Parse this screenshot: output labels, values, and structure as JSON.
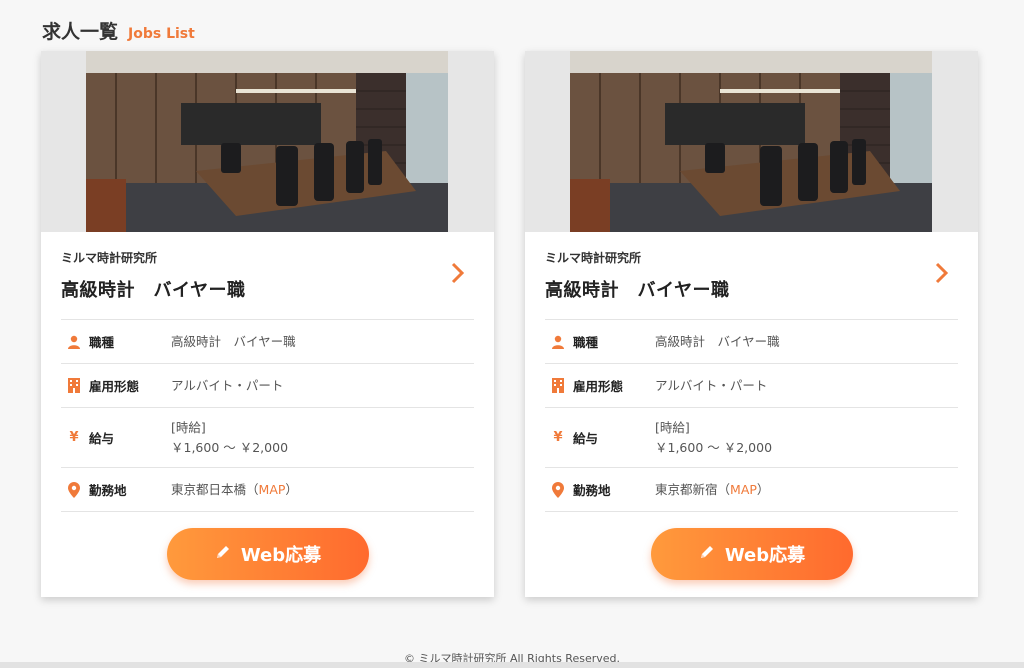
{
  "page": {
    "title_jp": "求人一覧",
    "title_en": "Jobs List"
  },
  "labels": {
    "occupation": "職種",
    "employment_type": "雇用形態",
    "salary": "給与",
    "location": "勤務地",
    "map_link": "MAP",
    "apply_button": "Web応募"
  },
  "jobs": [
    {
      "company": "ミルマ時計研究所",
      "title": "高級時計　バイヤー職",
      "occupation": "高級時計　バイヤー職",
      "employment_type": "アルバイト・パート",
      "salary_type": "[時給]",
      "salary_range": "￥1,600 〜 ￥2,000",
      "location": "東京都日本橋"
    },
    {
      "company": "ミルマ時計研究所",
      "title": "高級時計　バイヤー職",
      "occupation": "高級時計　バイヤー職",
      "employment_type": "アルバイト・パート",
      "salary_type": "[時給]",
      "salary_range": "￥1,600 〜 ￥2,000",
      "location": "東京都新宿"
    }
  ],
  "icons": {
    "occupation": "person-icon",
    "employment_type": "building-icon",
    "salary": "yen-icon",
    "location": "map-pin-icon",
    "apply": "pencil-icon",
    "detail": "chevron-right-icon"
  },
  "colors": {
    "accent": "#f07a3a",
    "button_start": "#ff9a3c",
    "button_end": "#ff6a2e"
  },
  "footer": {
    "copyright": "© ミルマ時計研究所 All Rights Reserved."
  }
}
